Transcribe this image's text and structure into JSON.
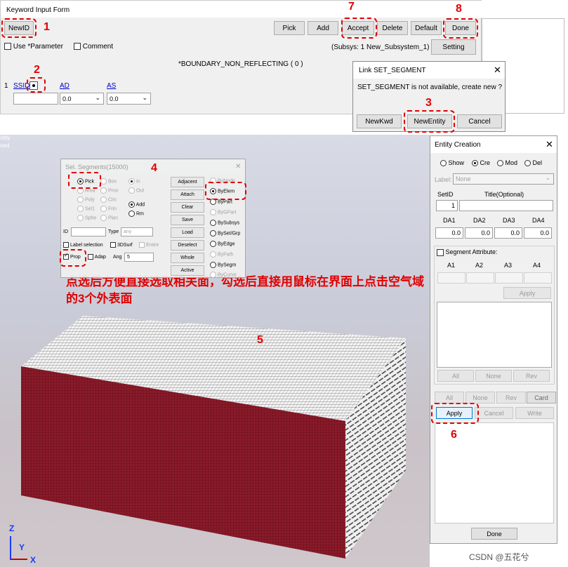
{
  "keyword_form": {
    "title": "Keyword Input Form",
    "newid_label": "NewID",
    "buttons": {
      "pick": "Pick",
      "add": "Add",
      "accept": "Accept",
      "delete": "Delete",
      "default": "Default",
      "done": "Done"
    },
    "use_parameter": "Use *Parameter",
    "comment": "Comment",
    "subsys": "(Subsys: 1 New_Subsystem_1)",
    "setting": "Setting",
    "keyword": "*BOUNDARY_NON_REFLECTING   ( 0 )",
    "row_index": "1",
    "fields": {
      "ssid": "SSID",
      "ad": "AD",
      "as": "AS"
    },
    "values": {
      "ad": "0.0",
      "as": "0.0"
    }
  },
  "link_dialog": {
    "title": "Link SET_SEGMENT",
    "message": "SET_SEGMENT is not available, create new ?",
    "newkwd": "NewKwd",
    "newentity": "NewEntity",
    "cancel": "Cancel"
  },
  "viewport": {
    "corner_text_1": "ntity",
    "corner_text_2": "ned",
    "annotation": "点选后方便直接选取相关面，勾选后直接用鼠标在界面上点击空气域的3个外表面",
    "axis_z": "Z",
    "axis_y": "Y",
    "axis_x": "X",
    "watermark": "CSDN @五花兮"
  },
  "sel_segments": {
    "title": "Sel. Segments(15000)",
    "left_options": [
      "Pick",
      "Area",
      "Poly",
      "Sel1",
      "Sphe"
    ],
    "mid_options": [
      "Box",
      "Prox",
      "Circ",
      "Frin",
      "Plan"
    ],
    "in": "In",
    "out": "Out",
    "add": "Add",
    "rm": "Rm",
    "id": "ID",
    "type": "Type",
    "type_value": "any",
    "label_selection": "Label selection",
    "surf3d": "3DSurf",
    "entire": "Entire",
    "prop": "Prop",
    "adap": "Adap",
    "ang": "Ang",
    "ang_value": "5",
    "buttons": [
      "Adjacent",
      "Attach",
      "Clear",
      "Save",
      "Load",
      "Deselect",
      "Whole",
      "Active"
    ],
    "by_options": [
      "ByNode",
      "ByElem",
      "ByPart",
      "ByGPart",
      "BySubsys",
      "BySet/Grp",
      "ByEdge",
      "ByPath",
      "BySegm",
      "ByCurve"
    ]
  },
  "entity_creation": {
    "title": "Entity Creation",
    "modes": [
      "Show",
      "Cre",
      "Mod",
      "Del"
    ],
    "label": "Label:",
    "label_value": "None",
    "setid": "SetID",
    "title_optional": "Title(Optional)",
    "setid_value": "1",
    "da_headers": [
      "DA1",
      "DA2",
      "DA3",
      "DA4"
    ],
    "da_values": [
      "0.0",
      "0.0",
      "0.0",
      "0.0"
    ],
    "segment_attribute": "Segment Attribute:",
    "a_headers": [
      "A1",
      "A2",
      "A3",
      "A4"
    ],
    "apply_small": "Apply",
    "list_buttons": [
      "All",
      "None",
      "Rev"
    ],
    "bottom_buttons": [
      "All",
      "None",
      "Rev",
      "Card"
    ],
    "apply": "Apply",
    "cancel": "Cancel",
    "write": "Write",
    "done": "Done"
  },
  "callouts": [
    "1",
    "2",
    "3",
    "4",
    "5",
    "6",
    "7",
    "8"
  ]
}
